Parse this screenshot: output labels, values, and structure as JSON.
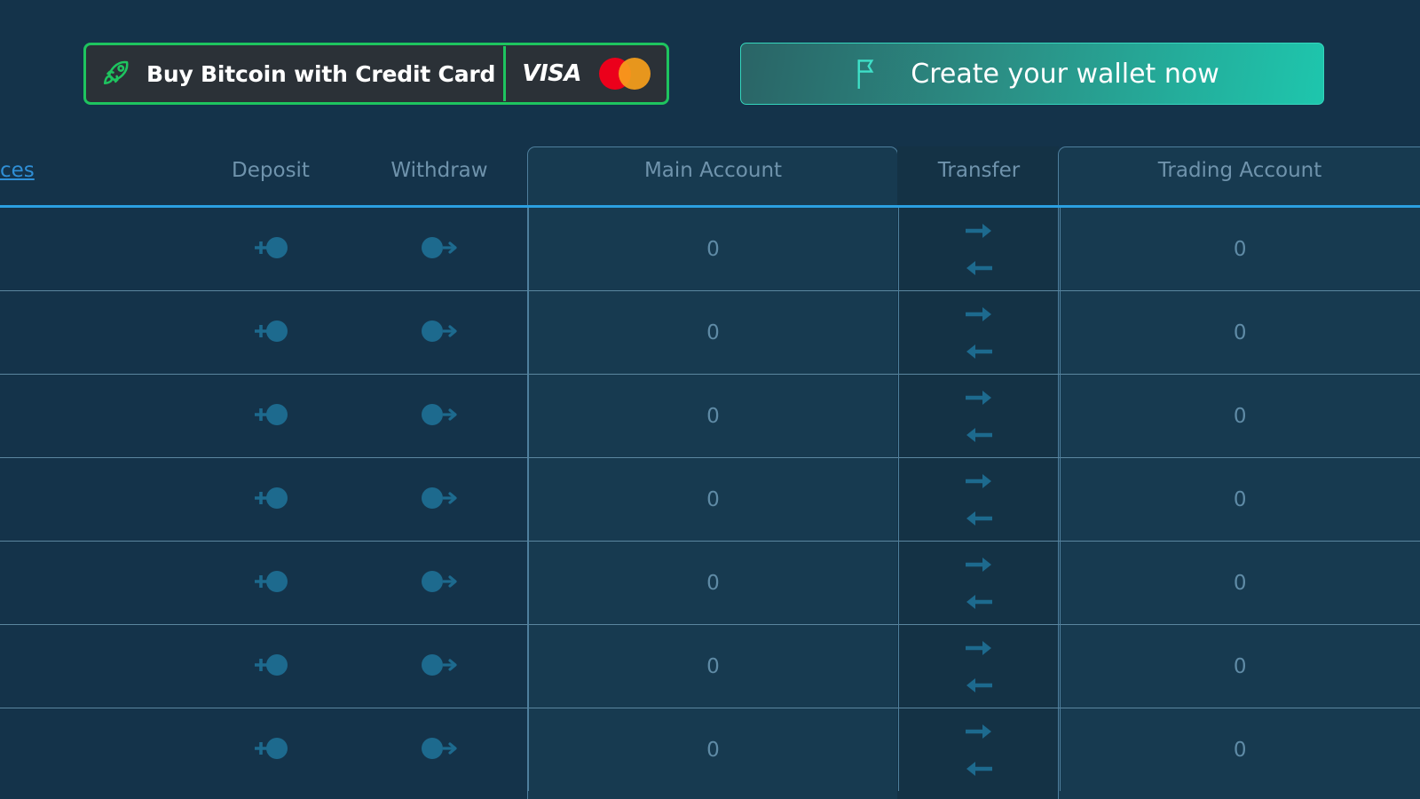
{
  "promo": {
    "buy_bitcoin": {
      "label": "Buy Bitcoin with Credit Card",
      "rocket_icon": "rocket-icon",
      "visa_label": "VISA",
      "mastercard_icon": "mastercard-icon",
      "border_color": "#1ec45f",
      "background_color": "#2b3137"
    },
    "create_wallet": {
      "label": "Create your wallet now",
      "flag_icon": "flag-icon",
      "accent_color": "#1ec6ad"
    }
  },
  "table": {
    "columns": [
      {
        "key": "asset",
        "label": "ces",
        "type": "link"
      },
      {
        "key": "deposit",
        "label": "Deposit",
        "type": "text"
      },
      {
        "key": "withdraw",
        "label": "Withdraw",
        "type": "text"
      },
      {
        "key": "main",
        "label": "Main Account",
        "type": "text"
      },
      {
        "key": "transfer",
        "label": "Transfer",
        "type": "text"
      },
      {
        "key": "trading",
        "label": "Trading Account",
        "type": "text"
      }
    ],
    "header_rule_color": "#2b9fe0",
    "row_border_color": "#5b869f",
    "column_border_color": "#4f7f9d",
    "icons": {
      "deposit": "deposit-icon",
      "withdraw": "withdraw-icon",
      "transfer_to": "arrow-right-icon",
      "transfer_from": "arrow-left-icon"
    },
    "rows": [
      {
        "main": "0",
        "trading": "0"
      },
      {
        "main": "0",
        "trading": "0"
      },
      {
        "main": "0",
        "trading": "0"
      },
      {
        "main": "0",
        "trading": "0"
      },
      {
        "main": "0",
        "trading": "0"
      },
      {
        "main": "0",
        "trading": "0"
      },
      {
        "main": "0",
        "trading": "0"
      }
    ]
  },
  "theme": {
    "page_background": "#14334a",
    "panel_background": "#173a50",
    "transfer_background": "#143245",
    "header_text": "#6f93ac",
    "amount_text": "#5f8ba6",
    "icon_color": "#1d6a8e"
  }
}
